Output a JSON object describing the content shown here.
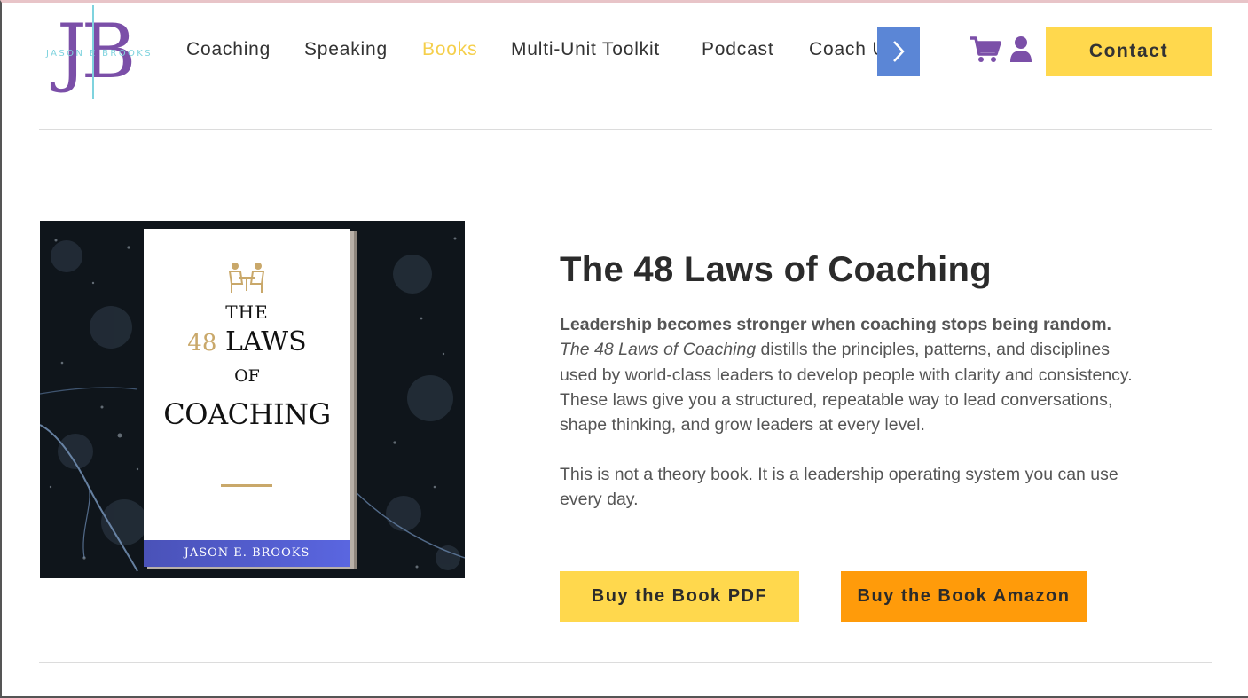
{
  "brand": {
    "monogram": "JB",
    "tagline": "JASON E BROOKS",
    "logo_primary_color": "#7b4fa8",
    "logo_accent_color": "#7fd3de"
  },
  "nav": {
    "items": [
      {
        "label": "Coaching",
        "active": false
      },
      {
        "label": "Speaking",
        "active": false
      },
      {
        "label": "Books",
        "active": true
      },
      {
        "label": "Multi-Unit Toolkit",
        "active": false
      },
      {
        "label": "Podcast",
        "active": false
      },
      {
        "label": "Coach Up",
        "active": false
      }
    ],
    "scroll_icon": "chevron-right-icon",
    "cart_icon": "shopping-cart-icon",
    "account_icon": "user-icon",
    "contact_label": "Contact",
    "active_color": "#f5cf4b"
  },
  "book_cover": {
    "line1": "THE",
    "number": "48",
    "line2": "LAWS",
    "line3": "OF",
    "line4": "COACHING",
    "author": "JASON E. BROOKS",
    "icon": "coaching-table-icon",
    "accent_color": "#c9a86a"
  },
  "product": {
    "title": "The 48 Laws of Coaching",
    "lead": "Leadership becomes stronger when coaching stops being random.",
    "book_name_italic": "The 48 Laws of Coaching",
    "body": " distills the principles, patterns, and disciplines used by world-class leaders to develop people with clarity and consistency. These laws give you a structured, repeatable way to lead conversations, shape thinking, and grow leaders at every level.",
    "body2": "This is not a theory book. It is a leadership operating system you can use every day."
  },
  "actions": {
    "buy_pdf_label": "Buy the Book PDF",
    "buy_amazon_label": "Buy the Book Amazon",
    "pdf_color": "#ffd84d",
    "amazon_color": "#ff9b0a"
  }
}
